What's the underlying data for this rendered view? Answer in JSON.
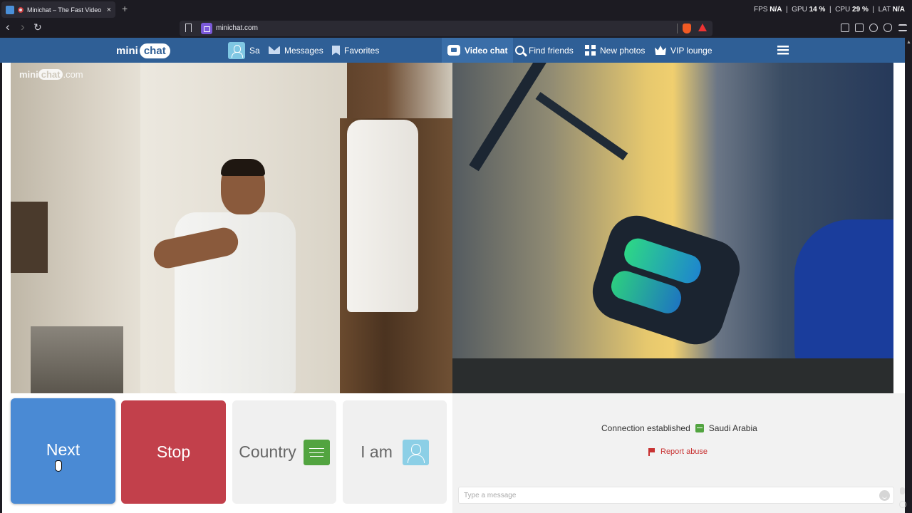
{
  "browser": {
    "tab_title": "Minichat – The Fast Video Ch",
    "tab_close": "×",
    "new_tab": "+",
    "url": "minichat.com",
    "perf": {
      "fps_label": "FPS",
      "fps_value": "N/A",
      "gpu_label": "GPU",
      "gpu_value": "14 %",
      "cpu_label": "CPU",
      "cpu_value": "29 %",
      "lat_label": "LAT",
      "lat_value": "N/A"
    },
    "back": "‹",
    "forward": "›",
    "reload": "↻"
  },
  "header": {
    "logo_mini": "mini",
    "logo_chat": "chat",
    "user_name": "Sa",
    "messages": "Messages",
    "favorites": "Favorites",
    "video_chat": "Video chat",
    "find_friends": "Find friends",
    "new_photos": "New photos",
    "vip_lounge": "VIP lounge"
  },
  "video": {
    "watermark_mini": "mini",
    "watermark_chat": "chat",
    "watermark_domain": ".com"
  },
  "controls": {
    "next": "Next",
    "stop": "Stop",
    "country": "Country",
    "i_am": "I am"
  },
  "chat": {
    "status": "Connection established",
    "country": "Saudi Arabia",
    "report": "Report abuse",
    "input_placeholder": "Type a message"
  },
  "colors": {
    "header_bg": "#2f5f96",
    "next_bg": "#4a8ad4",
    "stop_bg": "#c2404b",
    "country_flag": "#52a440",
    "report_text": "#c83232"
  }
}
